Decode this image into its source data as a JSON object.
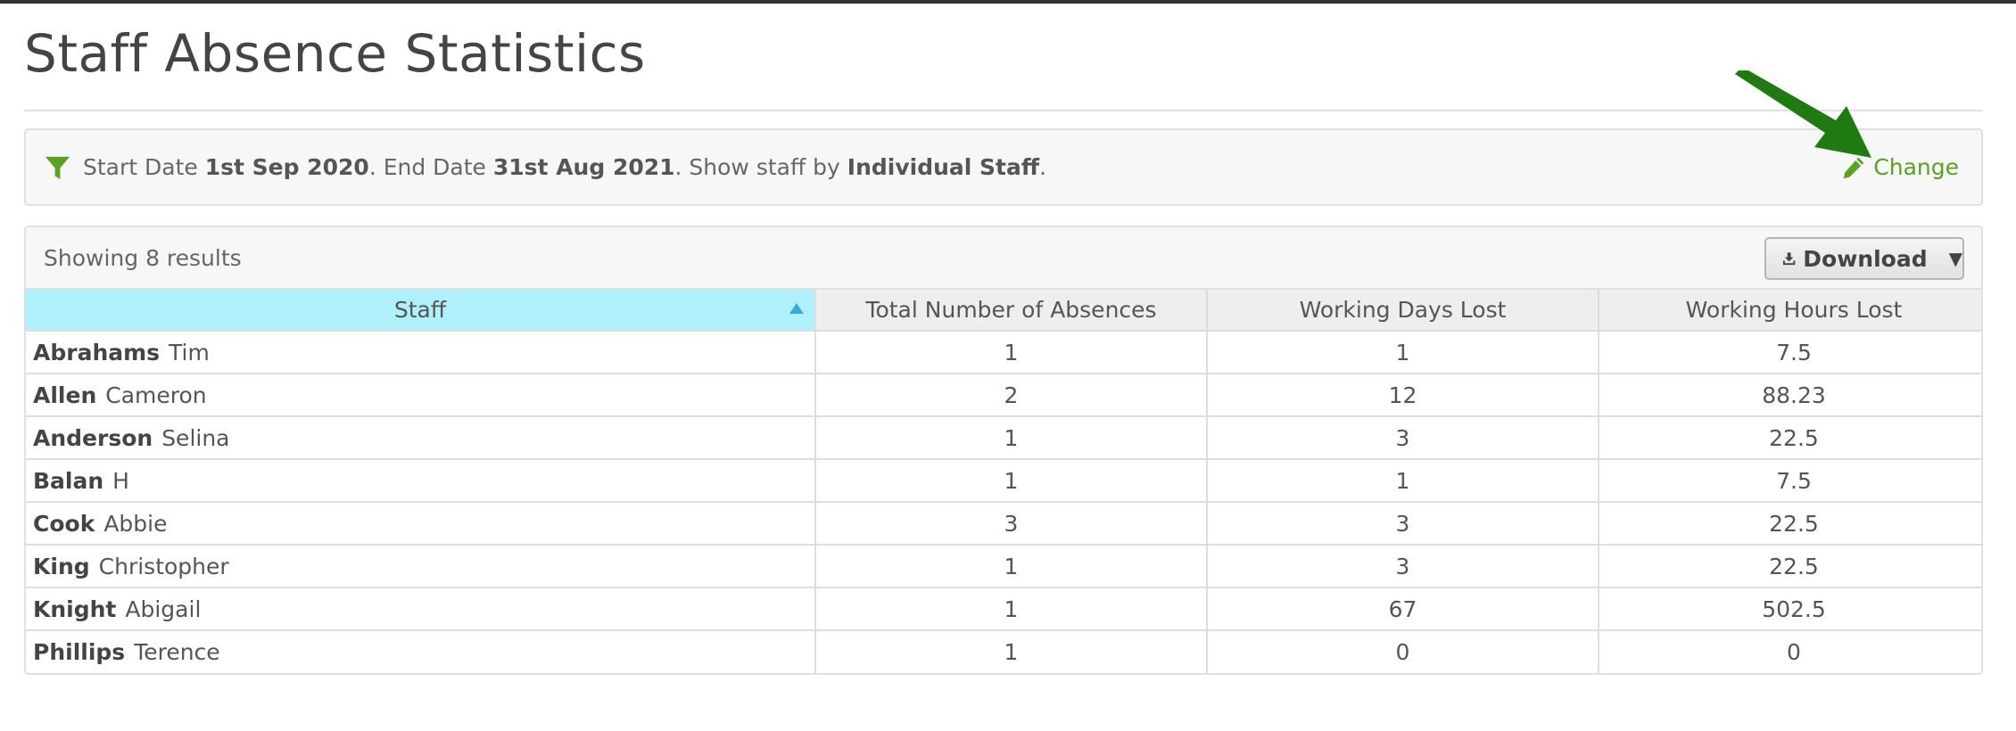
{
  "page": {
    "title": "Staff Absence Statistics"
  },
  "filter": {
    "start_label": "Start Date",
    "start_value": "1st Sep 2020",
    "end_label": ". End Date",
    "end_value": "31st Aug 2021",
    "show_label": ". Show staff by",
    "show_value": "Individual Staff",
    "end_punct": ".",
    "change_label": "Change",
    "icon": "filter-icon",
    "accent_color": "#5aa124"
  },
  "results": {
    "count_text": "Showing 8 results",
    "download_label": "Download"
  },
  "table": {
    "headers": [
      "Staff",
      "Total Number of Absences",
      "Working Days Lost",
      "Working Hours Lost"
    ],
    "sorted_column": "Staff",
    "sort_direction": "ascending",
    "rows": [
      {
        "surname": "Abrahams",
        "forename": "Tim",
        "absences": "1",
        "days_lost": "1",
        "hours_lost": "7.5"
      },
      {
        "surname": "Allen",
        "forename": "Cameron",
        "absences": "2",
        "days_lost": "12",
        "hours_lost": "88.23"
      },
      {
        "surname": "Anderson",
        "forename": "Selina",
        "absences": "1",
        "days_lost": "3",
        "hours_lost": "22.5"
      },
      {
        "surname": "Balan",
        "forename": "H",
        "absences": "1",
        "days_lost": "1",
        "hours_lost": "7.5"
      },
      {
        "surname": "Cook",
        "forename": "Abbie",
        "absences": "3",
        "days_lost": "3",
        "hours_lost": "22.5"
      },
      {
        "surname": "King",
        "forename": "Christopher",
        "absences": "1",
        "days_lost": "3",
        "hours_lost": "22.5"
      },
      {
        "surname": "Knight",
        "forename": "Abigail",
        "absences": "1",
        "days_lost": "67",
        "hours_lost": "502.5"
      },
      {
        "surname": "Phillips",
        "forename": "Terence",
        "absences": "1",
        "days_lost": "0",
        "hours_lost": "0"
      }
    ]
  },
  "colors": {
    "sorted_header": "#aef0fb",
    "annotation_arrow": "#1f7a12"
  }
}
